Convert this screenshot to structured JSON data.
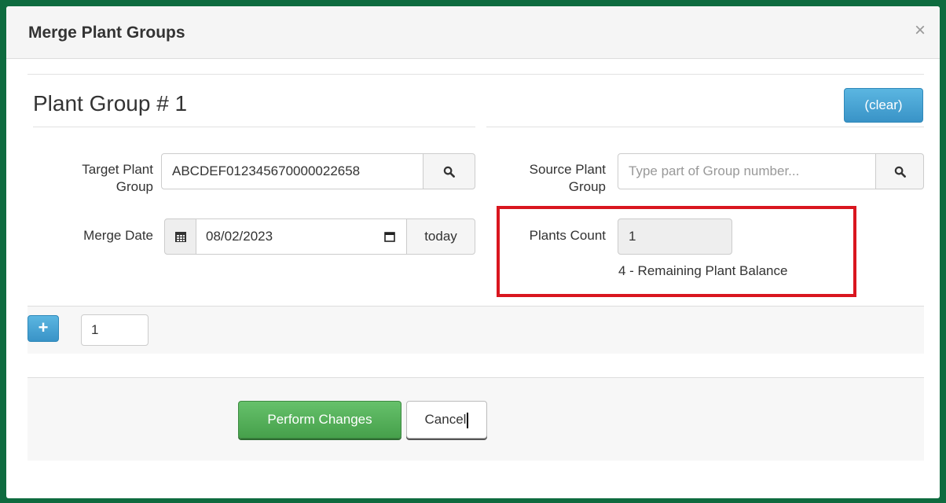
{
  "modal": {
    "title": "Merge Plant Groups",
    "close_glyph": "×"
  },
  "group": {
    "title": "Plant Group # 1",
    "clear_label": "(clear)"
  },
  "target_group": {
    "label_line1": "Target Plant",
    "label_line2": "Group",
    "value": "ABCDEF012345670000022658",
    "search_icon": "search-icon"
  },
  "source_group": {
    "label_line1": "Source Plant",
    "label_line2": "Group",
    "placeholder": "Type part of Group number...",
    "search_icon": "search-icon"
  },
  "merge_date": {
    "label": "Merge Date",
    "value": "08/02/2023",
    "calendar_icon": "calendar-icon",
    "today_label": "today"
  },
  "plants_count": {
    "label": "Plants Count",
    "value": "1",
    "help": "4 - Remaining Plant Balance"
  },
  "add_row": {
    "plus_label": "+",
    "count_value": "1"
  },
  "footer": {
    "perform_label": "Perform Changes",
    "cancel_label": "Cancel"
  },
  "colors": {
    "page_border": "#0e6b3f",
    "highlight": "#d9161f",
    "info_button": "#46a6d6",
    "success_button": "#5cb85c"
  }
}
